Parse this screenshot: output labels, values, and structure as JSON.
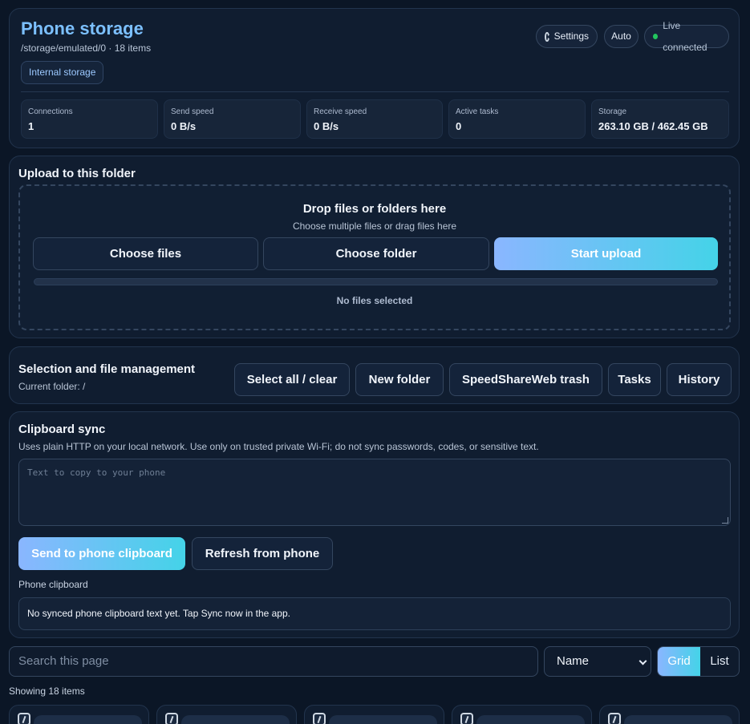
{
  "header": {
    "title": "Phone storage",
    "path": "/storage/emulated/0 · 18 items",
    "storage_chip": "Internal storage",
    "settings_label": "Settings",
    "auto_label": "Auto",
    "live_label": "Live connected",
    "stats": [
      {
        "label": "Connections",
        "value": "1"
      },
      {
        "label": "Send speed",
        "value": "0 B/s"
      },
      {
        "label": "Receive speed",
        "value": "0 B/s"
      },
      {
        "label": "Active tasks",
        "value": "0"
      },
      {
        "label": "Storage",
        "value": "263.10 GB / 462.45 GB"
      }
    ]
  },
  "upload": {
    "heading": "Upload to this folder",
    "drop_title": "Drop files or folders here",
    "drop_sub": "Choose multiple files or drag files here",
    "choose_files": "Choose files",
    "choose_folder": "Choose folder",
    "start_upload": "Start upload",
    "status": "No files selected"
  },
  "selection": {
    "heading": "Selection and file management",
    "current_folder": "Current folder: /",
    "select_all": "Select all / clear",
    "new_folder": "New folder",
    "trash": "SpeedShareWeb trash",
    "tasks": "Tasks",
    "history": "History"
  },
  "clipboard": {
    "heading": "Clipboard sync",
    "note": "Uses plain HTTP on your local network. Use only on trusted private Wi-Fi; do not sync passwords, codes, or sensitive text.",
    "placeholder": "Text to copy to your phone",
    "send": "Send to phone clipboard",
    "refresh": "Refresh from phone",
    "phone_label": "Phone clipboard",
    "phone_value": "No synced phone clipboard text yet. Tap Sync now in the app."
  },
  "toolbar": {
    "search_placeholder": "Search this page",
    "sort_value": "Name",
    "grid_label": "Grid",
    "list_label": "List",
    "showing": "Showing 18 items"
  },
  "colors": {
    "accent_start": "#8ab6ff",
    "accent_end": "#44d3e8",
    "live_dot": "#22c55e",
    "title": "#7cc0ff"
  }
}
